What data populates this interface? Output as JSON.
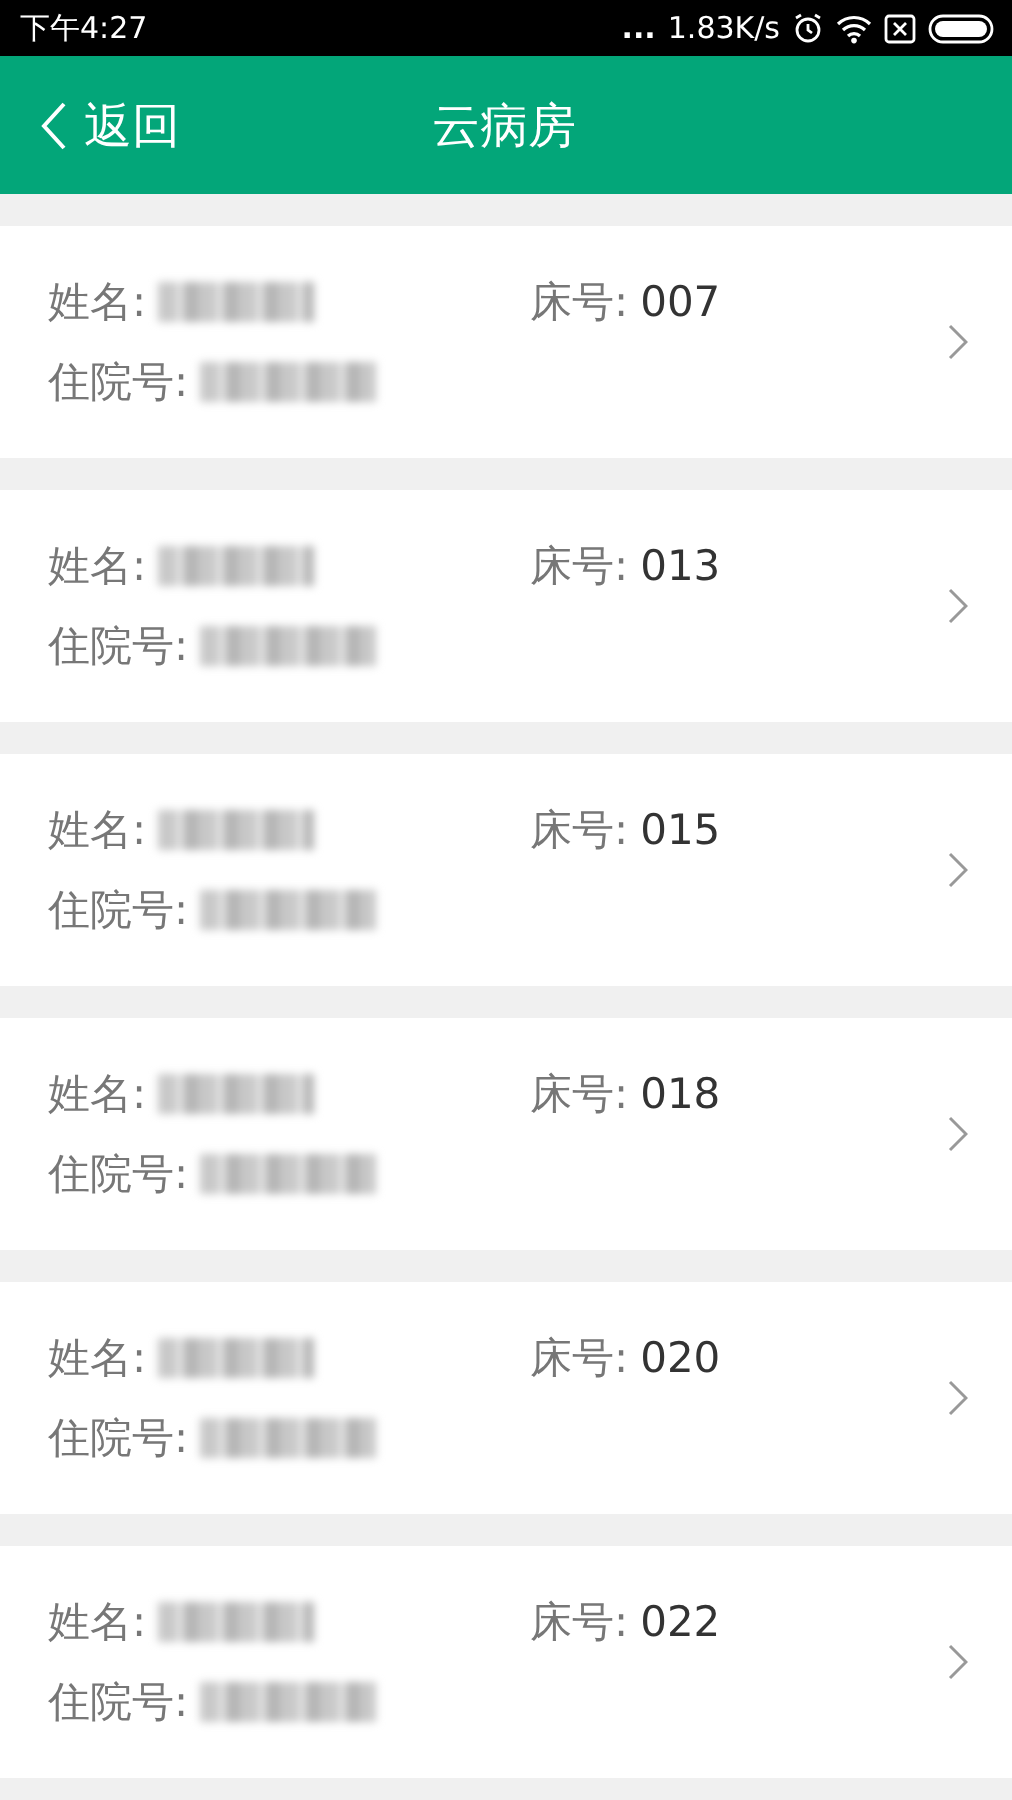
{
  "status_bar": {
    "time": "下午4:27",
    "more": "...",
    "speed": "1.83K/s"
  },
  "header": {
    "back": "返回",
    "title": "云病房"
  },
  "patients": [
    {
      "name_label": "姓名:",
      "bed_label": "床号:",
      "bed": "007",
      "id_label": "住院号:"
    },
    {
      "name_label": "姓名:",
      "bed_label": "床号:",
      "bed": "013",
      "id_label": "住院号:"
    },
    {
      "name_label": "姓名:",
      "bed_label": "床号:",
      "bed": "015",
      "id_label": "住院号:"
    },
    {
      "name_label": "姓名:",
      "bed_label": "床号:",
      "bed": "018",
      "id_label": "住院号:"
    },
    {
      "name_label": "姓名:",
      "bed_label": "床号:",
      "bed": "020",
      "id_label": "住院号:"
    },
    {
      "name_label": "姓名:",
      "bed_label": "床号:",
      "bed": "022",
      "id_label": "住院号:"
    }
  ]
}
